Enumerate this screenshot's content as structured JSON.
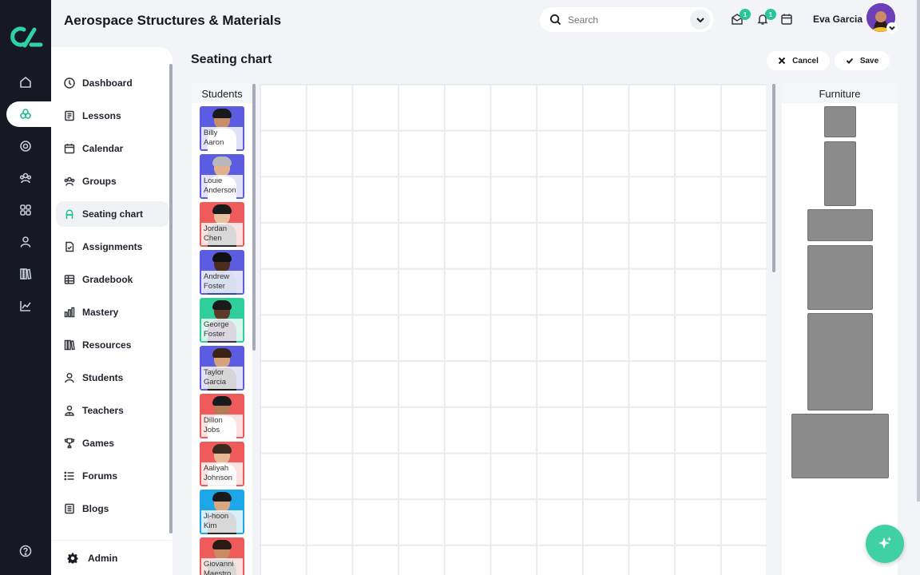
{
  "app": {
    "title": "Aerospace Structures & Materials"
  },
  "search": {
    "placeholder": "Search"
  },
  "header": {
    "mail_badge": "1",
    "notifications_badge": "1",
    "user_name": "Eva Garcia"
  },
  "sidebar": {
    "items": [
      {
        "label": "Dashboard",
        "icon": "dashboard-icon"
      },
      {
        "label": "Lessons",
        "icon": "lessons-icon"
      },
      {
        "label": "Calendar",
        "icon": "calendar-icon"
      },
      {
        "label": "Groups",
        "icon": "groups-icon"
      },
      {
        "label": "Seating chart",
        "icon": "seating-chart-icon",
        "active": true
      },
      {
        "label": "Assignments",
        "icon": "assignments-icon"
      },
      {
        "label": "Gradebook",
        "icon": "gradebook-icon"
      },
      {
        "label": "Mastery",
        "icon": "mastery-icon"
      },
      {
        "label": "Resources",
        "icon": "resources-icon"
      },
      {
        "label": "Students",
        "icon": "students-icon"
      },
      {
        "label": "Teachers",
        "icon": "teachers-icon"
      },
      {
        "label": "Games",
        "icon": "trophy-icon"
      },
      {
        "label": "Forums",
        "icon": "forums-icon"
      },
      {
        "label": "Blogs",
        "icon": "blogs-icon"
      }
    ],
    "admin_label": "Admin"
  },
  "page": {
    "title": "Seating chart",
    "cancel_label": "Cancel",
    "save_label": "Save"
  },
  "students_panel": {
    "title": "Students",
    "students": [
      {
        "first": "Billy",
        "last": "Aaron",
        "bg": "#5b5ce2"
      },
      {
        "first": "Louie",
        "last": "Anderson",
        "bg": "#5b5ce2"
      },
      {
        "first": "Jordan",
        "last": "Chen",
        "bg": "#ef5b5b"
      },
      {
        "first": "Andrew",
        "last": "Foster",
        "bg": "#5b5ce2"
      },
      {
        "first": "George",
        "last": "Foster",
        "bg": "#2fcf9b"
      },
      {
        "first": "Taylor",
        "last": "Garcia",
        "bg": "#5b5ce2"
      },
      {
        "first": "Dillon",
        "last": "Jobs",
        "bg": "#ef5b5b"
      },
      {
        "first": "Aaliyah",
        "last": "Johnson",
        "bg": "#ef5b5b"
      },
      {
        "first": "Ji-hoon",
        "last": "Kim",
        "bg": "#1ea7e8"
      },
      {
        "first": "Giovanni",
        "last": "Maestro",
        "bg": "#ef5b5b"
      }
    ]
  },
  "furniture_panel": {
    "title": "Furniture"
  },
  "colors": {
    "accent": "#1fbf8f",
    "rail": "#161823",
    "badge": "#27c59a"
  }
}
